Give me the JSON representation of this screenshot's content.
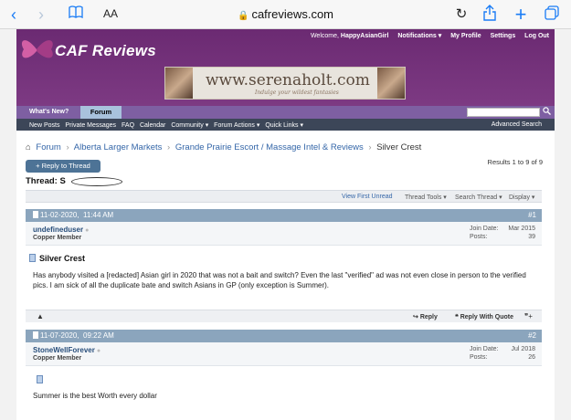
{
  "browser": {
    "url": "cafreviews.com",
    "text_size_label": "AA",
    "icons": [
      "back-icon",
      "forward-icon",
      "bookmarks-icon",
      "reload-icon",
      "share-icon",
      "new-tab-icon",
      "tabs-icon"
    ]
  },
  "header": {
    "site_name": "CAF Reviews",
    "welcome_prefix": "Welcome,",
    "username": "HappyAsianGirl",
    "links": [
      "Notifications ▾",
      "My Profile",
      "Settings",
      "Log Out"
    ],
    "banner_text": "www.serenaholt.com",
    "banner_tagline": "Indulge your wildest fantasies"
  },
  "nav": {
    "tabs": [
      "What's New?",
      "Forum"
    ],
    "search_placeholder": "",
    "sub_links": [
      "New Posts",
      "Private Messages",
      "FAQ",
      "Calendar",
      "Community ▾",
      "Forum Actions ▾",
      "Quick Links ▾"
    ],
    "advanced_search": "Advanced Search"
  },
  "breadcrumb": [
    "Forum",
    "Alberta Larger Markets",
    "Grande Prairie Escort / Massage Intel & Reviews",
    "Silver Crest"
  ],
  "thread": {
    "reply_button": "+ Reply to Thread",
    "results": "Results 1 to 9 of 9",
    "title_prefix": "Thread: S",
    "tools": [
      "View First Unread",
      "Thread Tools ▾",
      "Search Thread ▾",
      "Display ▾"
    ]
  },
  "posts": [
    {
      "date": "11-02-2020,",
      "time": "11:44 AM",
      "number": "#1",
      "username": "undefineduser",
      "rank": "Copper Member",
      "join_label": "Join Date:",
      "join_value": "Mar 2015",
      "posts_label": "Posts:",
      "posts_value": "39",
      "title": "Silver Crest",
      "body": "Has anybody visited a [redacted] Asian girl in 2020 that was not a bait and switch? Even the last \"verified\" ad was not even close in person to the verified pics. I am sick of all the duplicate bate and switch Asians in GP (only exception is Summer).",
      "actions": [
        "Reply",
        "Reply With Quote"
      ]
    },
    {
      "date": "11-07-2020,",
      "time": "09:22 AM",
      "number": "#2",
      "username": "StoneWellForever",
      "rank": "Copper Member",
      "join_label": "Join Date:",
      "join_value": "Jul 2018",
      "posts_label": "Posts:",
      "posts_value": "26",
      "body": "Summer is the best Worth every dollar"
    }
  ]
}
